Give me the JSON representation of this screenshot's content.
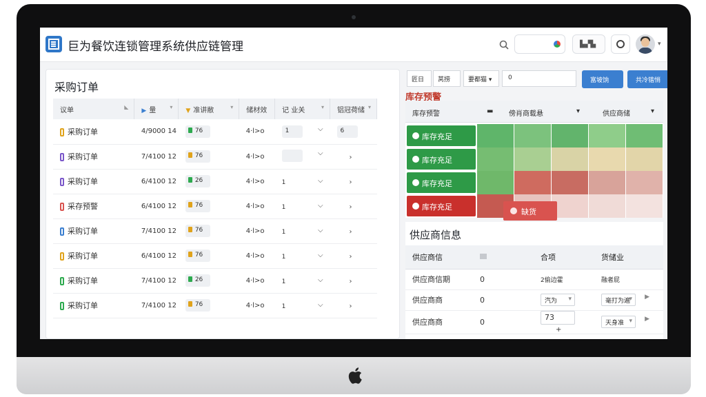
{
  "header": {
    "title": "巨为餐饮连锁管理系统供应链管理",
    "filter_button": "▙▞▙",
    "colors": {
      "brand": "#2f77c8",
      "accent": "#3b7fd0"
    }
  },
  "orders": {
    "title": "采购订单",
    "columns": [
      "议单",
      "量",
      "准讲敝",
      "储材效",
      "记 业关",
      "铝冠荷储"
    ],
    "rows": [
      {
        "name": "采购订单",
        "color": "#e0a31c",
        "no": "4/9000 14",
        "qty": "76",
        "qty_color": "#2eaa4f",
        "col4": "4·l>o",
        "tag": "1",
        "tag_color": "#e0a31c",
        "last": "6"
      },
      {
        "name": "采购订单",
        "color": "#7a57c9",
        "no": "7/4100 12",
        "qty": "76",
        "qty_color": "#e0a31c",
        "col4": "4·l>o",
        "tag": "",
        "tag_color": "#e0a31c",
        "last": ""
      },
      {
        "name": "采购订单",
        "color": "#7a57c9",
        "no": "6/4100 12",
        "qty": "26",
        "qty_color": "#2eaa4f",
        "col4": "4·l>o",
        "tag": "1",
        "tag_color": "",
        "last": ""
      },
      {
        "name": "采存预警",
        "color": "#d9534f",
        "no": "6/4100 12",
        "qty": "76",
        "qty_color": "#e0a31c",
        "col4": "4·l>o",
        "tag": "1",
        "tag_color": "",
        "last": ""
      },
      {
        "name": "采购订单",
        "color": "#3b7fd0",
        "no": "7/4100 12",
        "qty": "76",
        "qty_color": "#e0a31c",
        "col4": "4·l>o",
        "tag": "1",
        "tag_color": "",
        "last": ""
      },
      {
        "name": "采购订单",
        "color": "#e0a31c",
        "no": "6/4100 12",
        "qty": "76",
        "qty_color": "#e0a31c",
        "col4": "4·l>o",
        "tag": "1",
        "tag_color": "",
        "last": ""
      },
      {
        "name": "采购订单",
        "color": "#2eaa4f",
        "no": "7/4100 12",
        "qty": "26",
        "qty_color": "#2eaa4f",
        "col4": "4·l>o",
        "tag": "1",
        "tag_color": "",
        "last": ""
      },
      {
        "name": "采购订单",
        "color": "#2eaa4f",
        "no": "7/4100 12",
        "qty": "76",
        "qty_color": "#e0a31c",
        "col4": "4·l>o",
        "tag": "1",
        "tag_color": "",
        "last": ""
      }
    ]
  },
  "toolbar": {
    "seg1": "匠日",
    "seg2": "莴捞",
    "dropdown": "要都猫",
    "input_value": "0",
    "btn1": "富坡饷",
    "btn2": "共冷锴悄"
  },
  "stock": {
    "title": "库存预警",
    "columns": [
      "库存预警",
      "傍肖商载悬",
      "供应商储"
    ],
    "rows": [
      {
        "label": "库存充足",
        "color": "#2e9a47"
      },
      {
        "label": "库存充足",
        "color": "#2e9a47"
      },
      {
        "label": "库存充足",
        "color": "#2e9a47"
      },
      {
        "label": "库存充足",
        "color": "#c9302c"
      }
    ],
    "shortage_label": "缺货"
  },
  "suppliers": {
    "title": "供应商信息",
    "columns": [
      "供应商信",
      "合项",
      "货储业"
    ],
    "rows": [
      {
        "name": "供应商信期",
        "val": "0",
        "c3": "2偷边霍",
        "c4": "融者屁"
      },
      {
        "name": "供应商商",
        "val": "0",
        "c3": "汽为",
        "c4": "毫打为遍"
      },
      {
        "name": "供应商商",
        "val": "0",
        "c3": "73",
        "c4": "天身准"
      }
    ]
  }
}
